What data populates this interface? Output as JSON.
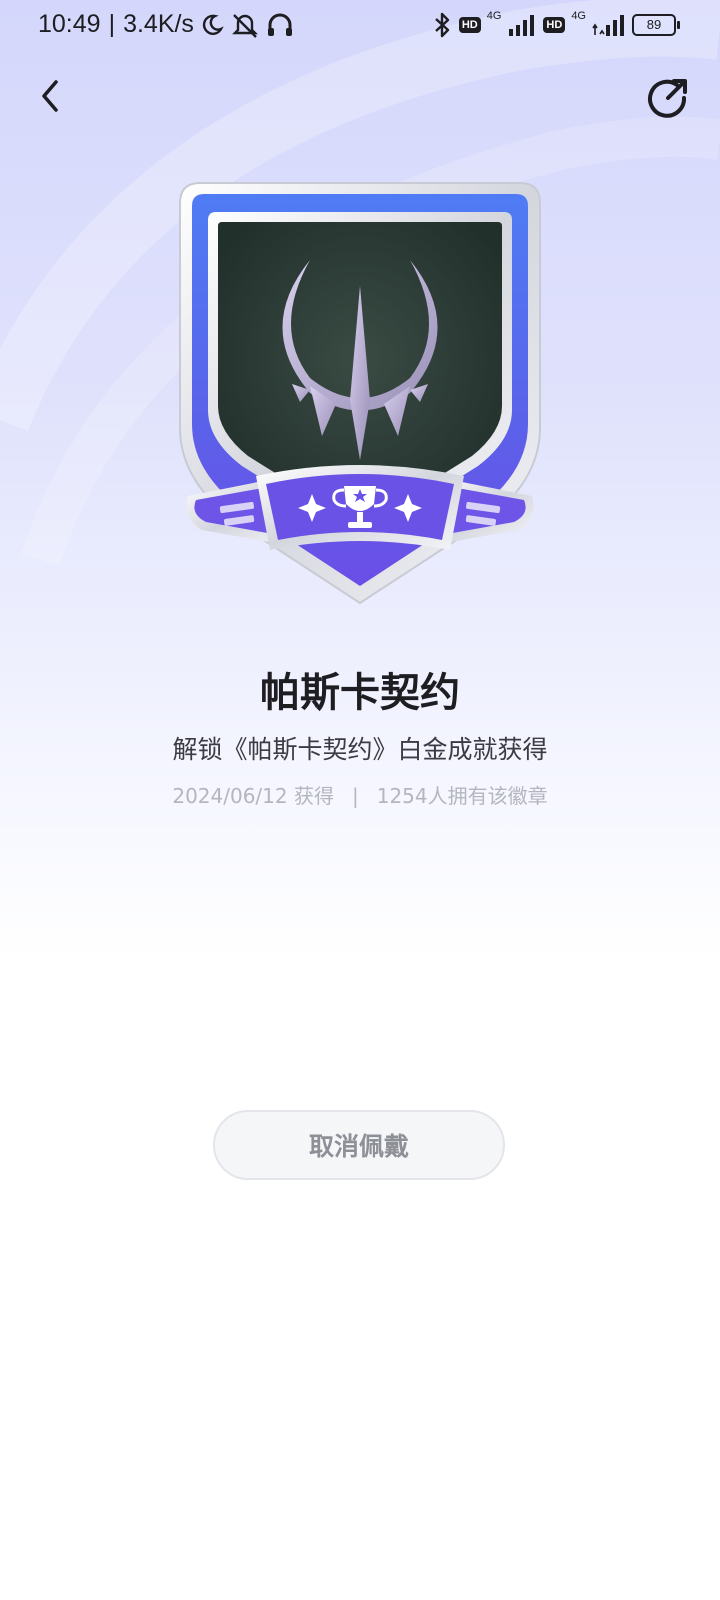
{
  "status_bar": {
    "time": "10:49",
    "separator": "|",
    "speed": "3.4K/s",
    "sim1_hd": "HD",
    "sim1_net": "4G",
    "sim2_hd": "HD",
    "sim2_net": "4G",
    "battery": "89"
  },
  "badge": {
    "name": "帕斯卡契约",
    "description": "解锁《帕斯卡契约》白金成就获得",
    "date": "2024/06/12 获得",
    "divider": "|",
    "owners": "1254人拥有该徽章"
  },
  "actions": {
    "cancel_wear": "取消佩戴"
  },
  "colors": {
    "accent_purple": "#6b4ee6",
    "accent_blue": "#4f7cf5",
    "badge_inner": "#2c3e36"
  }
}
